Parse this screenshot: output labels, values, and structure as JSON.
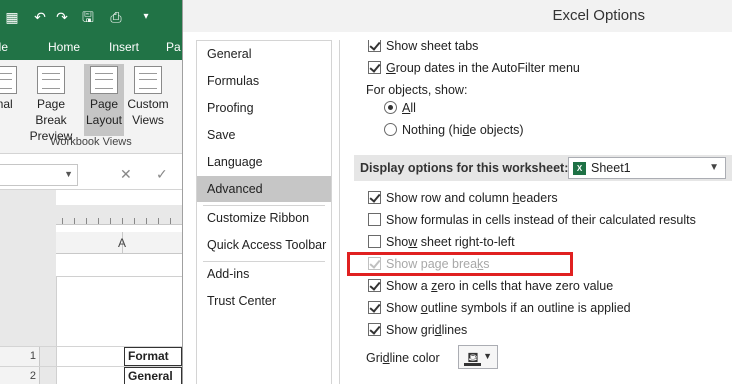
{
  "excel": {
    "ribbon_tabs": [
      "ile",
      "Home",
      "Insert",
      "Pa"
    ],
    "ribbon_buttons": [
      {
        "line1": "mal",
        "line2": ""
      },
      {
        "line1": "Page Break",
        "line2": "Preview"
      },
      {
        "line1": "Page",
        "line2": "Layout"
      },
      {
        "line1": "Custom",
        "line2": "Views"
      }
    ],
    "group_label": "Workbook Views",
    "column_header": "A",
    "rows": [
      {
        "num": "1",
        "value": "Format"
      },
      {
        "num": "2",
        "value": "General"
      }
    ]
  },
  "dialog": {
    "title": "Excel Options",
    "nav": [
      "General",
      "Formulas",
      "Proofing",
      "Save",
      "Language",
      "Advanced",
      "Customize Ribbon",
      "Quick Access Toolbar",
      "Add-ins",
      "Trust Center"
    ],
    "active_nav": "Advanced",
    "workbook_options": {
      "show_sheet_tabs": {
        "label": "Show sheet tabs",
        "checked": true
      },
      "group_dates": {
        "label_pre": "",
        "label_u": "G",
        "label_post": "roup dates in the AutoFilter menu",
        "checked": true
      },
      "for_objects_label": "For objects, show:",
      "objects_all": {
        "label_u": "A",
        "label_post": "ll",
        "selected": true
      },
      "objects_nothing": {
        "label_pre": "Nothing (hi",
        "label_u": "d",
        "label_post": "e objects)",
        "selected": false
      }
    },
    "worksheet_section": {
      "label": "Display options for this worksheet:",
      "sheet": "Sheet1"
    },
    "worksheet_options": [
      {
        "pre": "Show row and column ",
        "u": "h",
        "post": "eaders",
        "checked": true,
        "disabled": false
      },
      {
        "pre": "Show formulas in cells instead of their calculated results",
        "u": "",
        "post": "",
        "checked": false,
        "disabled": false
      },
      {
        "pre": "Sho",
        "u": "w",
        "post": " sheet right-to-left",
        "checked": false,
        "disabled": false
      },
      {
        "pre": "Show page brea",
        "u": "k",
        "post": "s",
        "checked": true,
        "disabled": true
      },
      {
        "pre": "Show a ",
        "u": "z",
        "post": "ero in cells that have zero value",
        "checked": true,
        "disabled": false
      },
      {
        "pre": "Show ",
        "u": "o",
        "post": "utline symbols if an outline is applied",
        "checked": true,
        "disabled": false
      },
      {
        "pre": "Show gri",
        "u": "d",
        "post": "lines",
        "checked": true,
        "disabled": false
      }
    ],
    "gridline_color": {
      "label_pre": "Gri",
      "label_u": "d",
      "label_post": "line color"
    },
    "highlight_color": "#e02020",
    "accent_color": "#217346"
  }
}
